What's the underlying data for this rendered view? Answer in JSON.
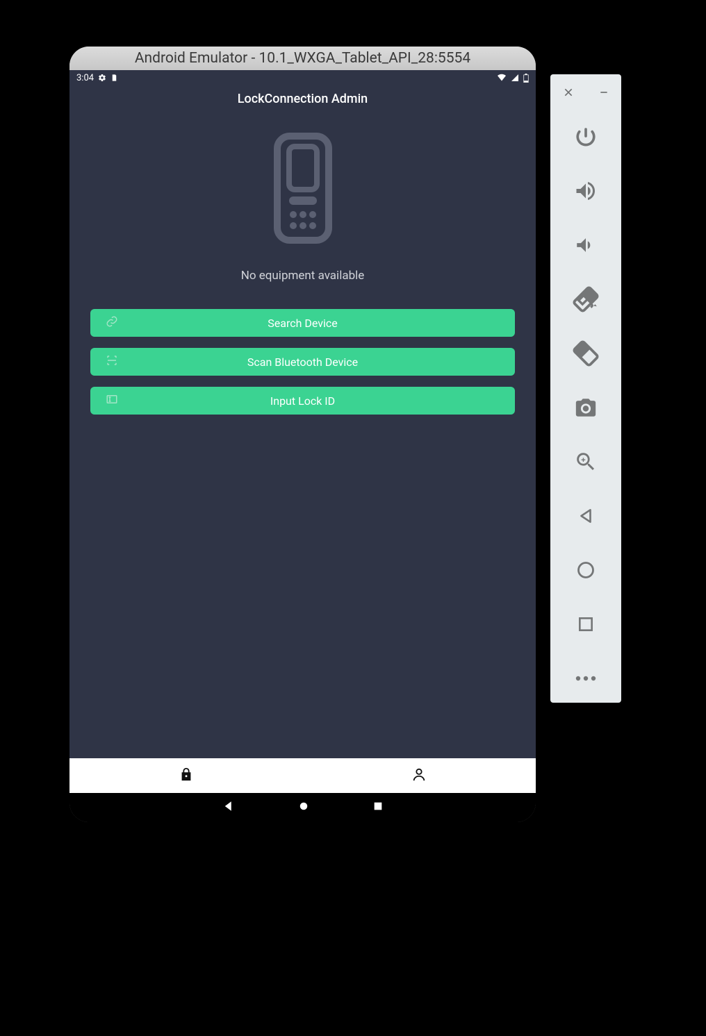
{
  "emulator": {
    "title": "Android Emulator - 10.1_WXGA_Tablet_API_28:5554"
  },
  "statusbar": {
    "time": "3:04"
  },
  "app": {
    "title": "LockConnection Admin",
    "empty_state_text": "No equipment available",
    "buttons": {
      "search_device": "Search Device",
      "scan_bluetooth": "Scan Bluetooth Device",
      "input_lock_id": "Input Lock ID"
    }
  },
  "side_toolbar": {
    "icons": [
      "power-icon",
      "volume-up-icon",
      "volume-down-icon",
      "rotate-left-icon",
      "rotate-right-icon",
      "camera-icon",
      "zoom-in-icon",
      "back-icon",
      "home-icon",
      "overview-icon",
      "more-icon"
    ]
  }
}
